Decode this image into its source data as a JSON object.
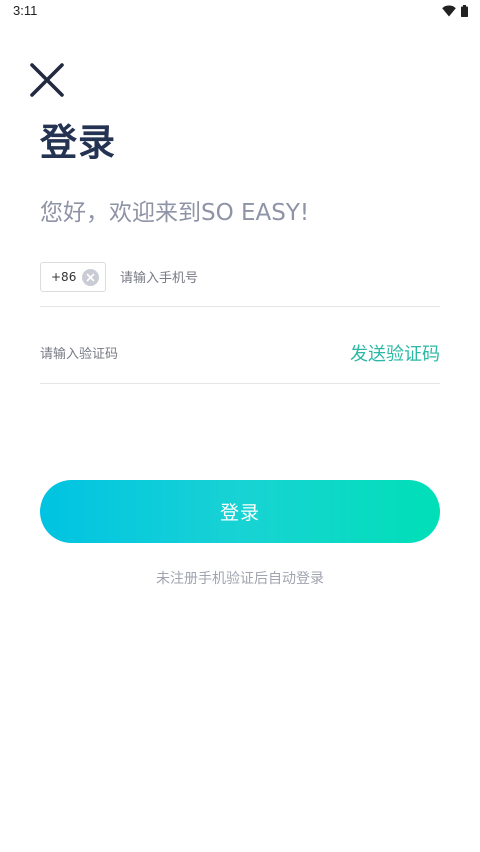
{
  "status_bar": {
    "time": "3:11",
    "wifi_icon": "wifi-icon",
    "battery_icon": "battery-icon"
  },
  "header": {
    "close_icon": "close-icon",
    "title": "登录",
    "welcome": "您好，欢迎来到SO EASY!"
  },
  "phone": {
    "country_code": "+86",
    "clear_icon": "clear-circle-icon",
    "placeholder": "请输入手机号",
    "value": ""
  },
  "verification": {
    "placeholder": "请输入验证码",
    "value": "",
    "send_label": "发送验证码"
  },
  "login": {
    "button_label": "登录",
    "hint": "未注册手机验证后自动登录"
  },
  "colors": {
    "title": "#253352",
    "accent": "#2bb9a5",
    "gradient_start": "#00c3e2",
    "gradient_end": "#00dfb7"
  }
}
